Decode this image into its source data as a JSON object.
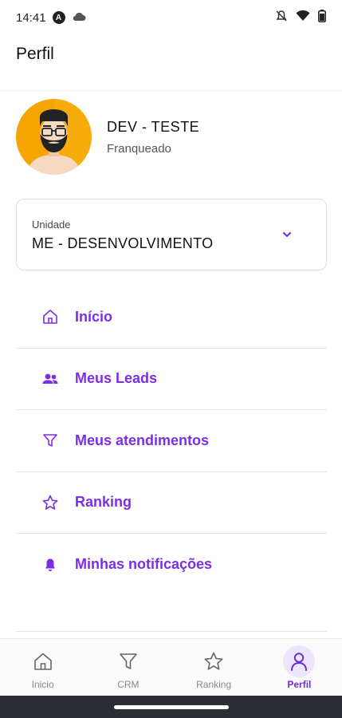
{
  "status_bar": {
    "time": "14:41",
    "badge": "A",
    "icons_left": [
      "a-badge-icon",
      "cloud-icon"
    ],
    "icons_right": [
      "notifications-off-icon",
      "wifi-icon",
      "battery-icon"
    ]
  },
  "appbar": {
    "title": "Perfil"
  },
  "profile": {
    "name": "DEV - TESTE",
    "role": "Franqueado",
    "avatar_icon": "bearded-man-avatar"
  },
  "unit": {
    "label": "Unidade",
    "value": "ME - DESENVOLVIMENTO",
    "icon": "chevron-down-icon"
  },
  "menu": {
    "items": [
      {
        "label": "Início",
        "icon": "home-icon"
      },
      {
        "label": "Meus Leads",
        "icon": "people-icon"
      },
      {
        "label": "Meus atendimentos",
        "icon": "filter-icon"
      },
      {
        "label": "Ranking",
        "icon": "star-icon"
      },
      {
        "label": "Minhas notificações",
        "icon": "bell-icon"
      }
    ]
  },
  "bottom_nav": {
    "tabs": [
      {
        "label": "Inicio",
        "icon": "home-icon",
        "active": false
      },
      {
        "label": "CRM",
        "icon": "filter-icon",
        "active": false
      },
      {
        "label": "Ranking",
        "icon": "star-icon",
        "active": false
      },
      {
        "label": "Perfil",
        "icon": "user-icon",
        "active": true
      }
    ]
  },
  "colors": {
    "accent": "#7c2ee6",
    "active_tab": "#6b2fd6",
    "active_tab_bg": "#ede5fb",
    "nav_inactive": "#8a8a8a"
  }
}
